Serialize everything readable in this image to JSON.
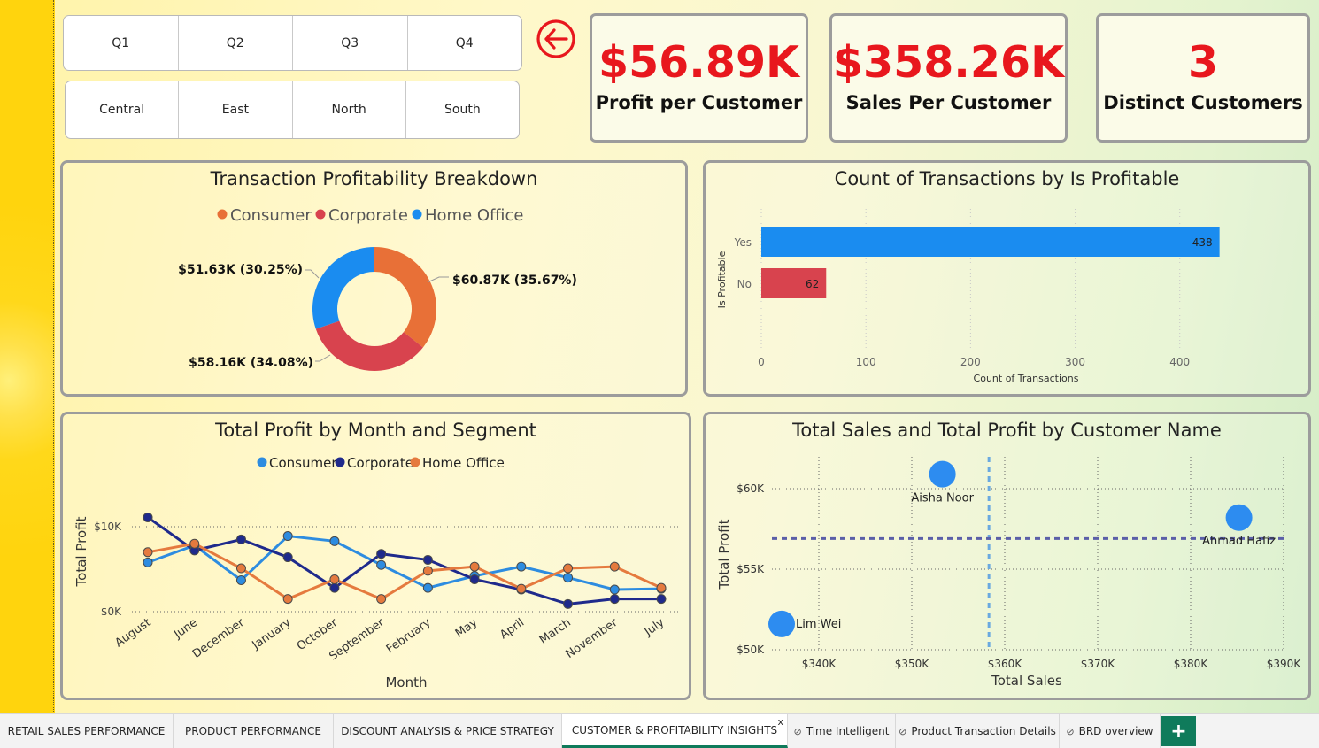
{
  "slicers": {
    "quarters": [
      "Q1",
      "Q2",
      "Q3",
      "Q4"
    ],
    "regions": [
      "Central",
      "East",
      "North",
      "South"
    ]
  },
  "back_button": {
    "icon": "arrow-left-circle-icon",
    "color": "#e8171d"
  },
  "cards": [
    {
      "value": "$56.89K",
      "label": "Profit per Customer"
    },
    {
      "value": "$358.26K",
      "label": "Sales Per Customer"
    },
    {
      "value": "3",
      "label": "Distinct Customers"
    }
  ],
  "colors": {
    "accent_red": "#e8171d",
    "consumer": "#e87037",
    "corporate": "#d8434e",
    "home_office": "#1a8cf0",
    "line_consumer": "#2d8ce0",
    "line_corporate": "#1f2a8c",
    "line_home": "#e57a3e",
    "bar_yes": "#1a8cf0",
    "bar_no": "#d8434e",
    "bubble": "#2d8cf0"
  },
  "chart_data": [
    {
      "type": "pie",
      "title": "Transaction Profitability Breakdown",
      "legend": [
        "Consumer",
        "Corporate",
        "Home Office"
      ],
      "legend_position": "top",
      "slices": [
        {
          "name": "Consumer",
          "value": 60.87,
          "label": "$60.87K (35.67%)"
        },
        {
          "name": "Corporate",
          "value": 58.16,
          "label": "$58.16K (34.08%)"
        },
        {
          "name": "Home Office",
          "value": 51.63,
          "label": "$51.63K (30.25%)"
        }
      ]
    },
    {
      "type": "bar",
      "orientation": "horizontal",
      "title": "Count of Transactions by Is Profitable",
      "xlabel": "Count of Transactions",
      "ylabel": "Is Profitable",
      "categories": [
        "Yes",
        "No"
      ],
      "values": [
        438,
        62
      ],
      "xlim": [
        0,
        440
      ],
      "xticks": [
        0,
        100,
        200,
        300,
        400
      ],
      "grid": true
    },
    {
      "type": "line",
      "title": "Total Profit by Month and Segment",
      "xlabel": "Month",
      "ylabel": "Total Profit",
      "categories": [
        "August",
        "June",
        "December",
        "January",
        "October",
        "September",
        "February",
        "May",
        "April",
        "March",
        "November",
        "July"
      ],
      "ylim": [
        0,
        11
      ],
      "yticks": [
        {
          "v": 0,
          "label": "$0K"
        },
        {
          "v": 10,
          "label": "$10K"
        }
      ],
      "legend_position": "top",
      "series": [
        {
          "name": "Consumer",
          "values": [
            5.8,
            7.8,
            3.7,
            8.9,
            8.3,
            5.5,
            2.8,
            4.2,
            5.3,
            4.0,
            2.6,
            2.7
          ]
        },
        {
          "name": "Corporate",
          "values": [
            11.1,
            7.2,
            8.5,
            6.4,
            2.8,
            6.8,
            6.1,
            3.8,
            2.6,
            0.9,
            1.5,
            1.5
          ]
        },
        {
          "name": "Home Office",
          "values": [
            7.0,
            8.0,
            5.1,
            1.5,
            3.8,
            1.5,
            4.8,
            5.3,
            2.7,
            5.1,
            5.3,
            2.8
          ]
        }
      ]
    },
    {
      "type": "scatter",
      "title": "Total Sales and Total Profit by Customer Name",
      "xlabel": "Total Sales",
      "ylabel": "Total Profit",
      "xlim": [
        335,
        390
      ],
      "ylim": [
        50,
        61
      ],
      "xticks": [
        {
          "v": 340,
          "label": "$340K"
        },
        {
          "v": 350,
          "label": "$350K"
        },
        {
          "v": 360,
          "label": "$360K"
        },
        {
          "v": 370,
          "label": "$370K"
        },
        {
          "v": 380,
          "label": "$380K"
        },
        {
          "v": 390,
          "label": "$390K"
        }
      ],
      "yticks": [
        {
          "v": 50,
          "label": "$50K"
        },
        {
          "v": 55,
          "label": "$55K"
        },
        {
          "v": 60,
          "label": "$60K"
        }
      ],
      "points": [
        {
          "name": "Aisha Noor",
          "x": 353.3,
          "y": 60.9
        },
        {
          "name": "Ahmad Hafiz",
          "x": 385.2,
          "y": 58.2
        },
        {
          "name": "Lim Wei",
          "x": 336.0,
          "y": 51.6
        }
      ],
      "avg_x": 358.3,
      "avg_y": 56.9
    }
  ],
  "tabs": [
    {
      "label": "RETAIL SALES PERFORMANCE",
      "hidden": false
    },
    {
      "label": "PRODUCT PERFORMANCE",
      "hidden": false
    },
    {
      "label": "DISCOUNT ANALYSIS & PRICE STRATEGY",
      "hidden": false
    },
    {
      "label": "CUSTOMER & PROFITABILITY INSIGHTS",
      "hidden": false,
      "active": true,
      "close": "x"
    },
    {
      "label": "Time Intelligent",
      "hidden": true
    },
    {
      "label": "Product Transaction Details",
      "hidden": true
    },
    {
      "label": "BRD overview",
      "hidden": true
    }
  ],
  "add_tab": "+"
}
